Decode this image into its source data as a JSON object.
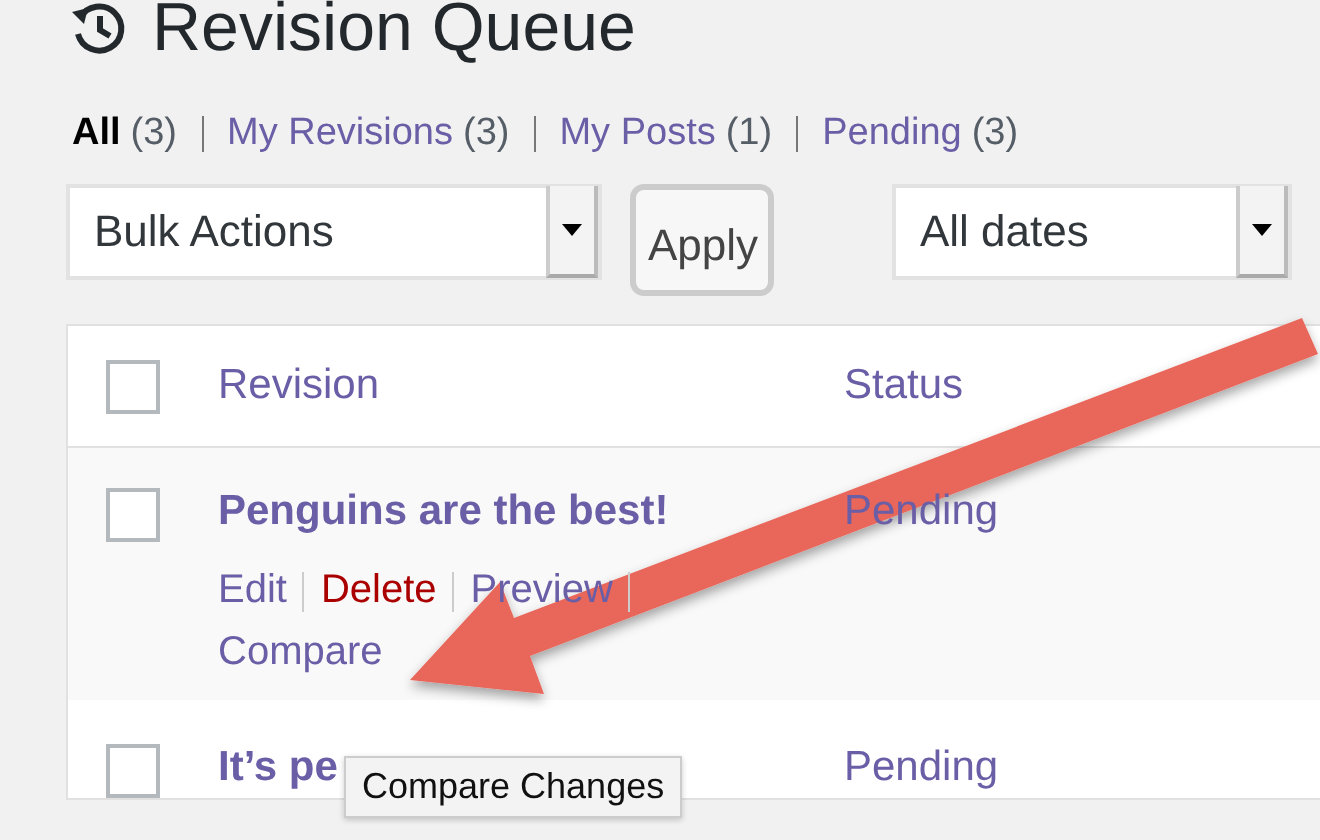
{
  "title": "Revision Queue",
  "filters": [
    {
      "label": "All",
      "count": "(3)",
      "selected": true
    },
    {
      "label": "My Revisions",
      "count": "(3)",
      "selected": false
    },
    {
      "label": "My Posts",
      "count": "(1)",
      "selected": false
    },
    {
      "label": "Pending",
      "count": "(3)",
      "selected": false
    }
  ],
  "bulk_actions": {
    "value": "Bulk Actions"
  },
  "apply_button": "Apply",
  "date_filter": {
    "value": "All dates"
  },
  "table": {
    "select_all_checked": false,
    "columns": [
      "Revision",
      "Status"
    ],
    "rows": [
      {
        "title": "Penguins are the best!",
        "status": "Pending",
        "checked": false,
        "actions": [
          {
            "label": "Edit",
            "kind": "normal"
          },
          {
            "label": "Delete",
            "kind": "danger"
          },
          {
            "label": "Preview",
            "kind": "normal"
          },
          {
            "label": "Compare",
            "kind": "normal"
          }
        ]
      },
      {
        "title": "It’s pe",
        "status": "Pending",
        "checked": false
      }
    ]
  },
  "tooltip": "Compare Changes"
}
